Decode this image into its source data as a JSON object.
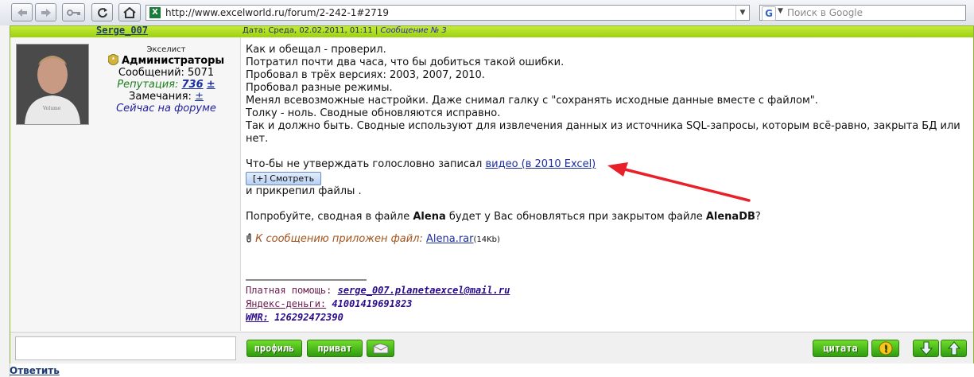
{
  "browser": {
    "url": "http://www.excelworld.ru/forum/2-242-1#2719",
    "search_placeholder": "Поиск в Google",
    "favicon": "X",
    "google_icon": "G"
  },
  "post": {
    "author": "Serge_007",
    "date": "Дата: Среда, 02.02.2011, 01:11",
    "sep": " | ",
    "msg_num": "Сообщение № 3",
    "user": {
      "rank": "Экселист",
      "group": "Администраторы",
      "messages": "Сообщений: 5071",
      "rep_label": "Репутация: ",
      "rep_value": "736",
      "rep_pm": "±",
      "warn_label": "Замечания: ",
      "warn_pm": "±",
      "online": "Сейчас на форуме"
    },
    "lines": [
      "Как и обещал - проверил.",
      "Потратил почти два часа, что бы добиться такой ошибки.",
      "Пробовал в трёх версиях: 2003, 2007, 2010.",
      "Пробовал разные режимы.",
      "Менял всевозможные настройки. Даже снимал галку с \"сохранять исходные данные вместе с файлом\".",
      "Толку - ноль. Сводные обновляются исправно.",
      "Так и должно быть. Сводные используют для извлечения данных из источника SQL-запросы, которым всё-равно, закрыта БД или нет."
    ],
    "video_pre": "Что-бы не утверждать голословно записал ",
    "video_link": "видео (в 2010 Excel)",
    "spoiler": "[+] Смотреть",
    "attached": "и прикрепил файлы .",
    "try_pre": "Попробуйте, сводная в файле ",
    "try_b1": "Alena",
    "try_mid": " будет у Вас обновляться при закрытом файле ",
    "try_b2": "AlenaDB",
    "try_end": "?",
    "attach_label": "К сообщению приложен файл: ",
    "attach_file": "Alena.rar",
    "attach_size": "(14Kb)",
    "sig": {
      "paid_label": "Платная помощь:",
      "paid_val": "serge_007.planetaexcel@mail.ru",
      "yandex_label": "Яндекс-деньги:",
      "yandex_val": "41001419691823",
      "wmr_label": "WMR:",
      "wmr_val": "126292472390"
    }
  },
  "buttons": {
    "profile": "профиль",
    "private": "приват",
    "quote": "цитата",
    "warn": "!"
  },
  "reply": "Ответить",
  "colors": {
    "accent": "#9bd10f",
    "arrow": "#e8202a",
    "link": "#1d2fa0"
  }
}
